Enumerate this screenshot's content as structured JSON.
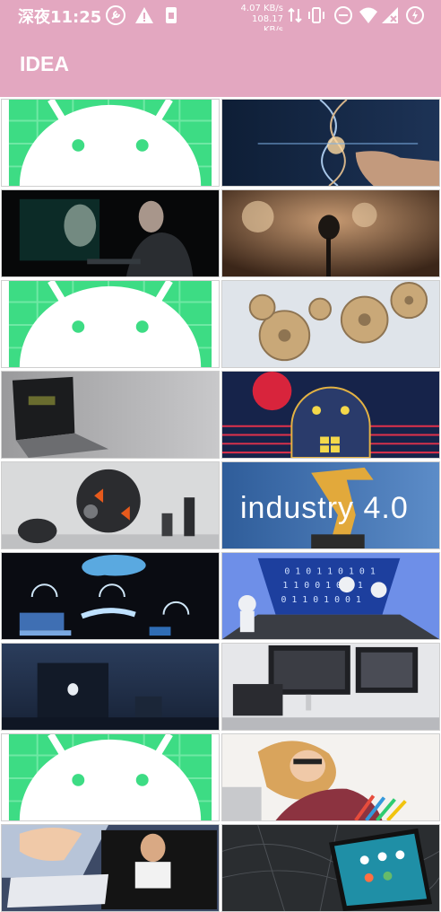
{
  "status_bar": {
    "time": "深夜11:25",
    "download_speed": "4.07 KB/s",
    "upload_speed": "108.17 KB/s",
    "icons": [
      "wrench-icon",
      "alert-icon",
      "sim-icon",
      "arrows-updown-icon",
      "vibrate-icon",
      "dnd-icon",
      "wifi-icon",
      "signal-icon",
      "battery-icon"
    ]
  },
  "app_bar": {
    "title": "IDEA"
  },
  "colors": {
    "accent": "#e3a7c0",
    "android_green": "#3ddc84"
  },
  "tiles": [
    {
      "kind": "android-logo"
    },
    {
      "kind": "dna-hand"
    },
    {
      "kind": "digital-face"
    },
    {
      "kind": "microphone"
    },
    {
      "kind": "android-logo"
    },
    {
      "kind": "gears"
    },
    {
      "kind": "laptop-dark"
    },
    {
      "kind": "android-windows"
    },
    {
      "kind": "robot-chess"
    },
    {
      "kind": "industry-4",
      "caption": "industry 4.0"
    },
    {
      "kind": "cloud-iot"
    },
    {
      "kind": "laptop-binary"
    },
    {
      "kind": "macbook-dark"
    },
    {
      "kind": "desk-monitors"
    },
    {
      "kind": "android-logo"
    },
    {
      "kind": "woman-study"
    },
    {
      "kind": "tablet-woman"
    },
    {
      "kind": "phone-map"
    }
  ]
}
